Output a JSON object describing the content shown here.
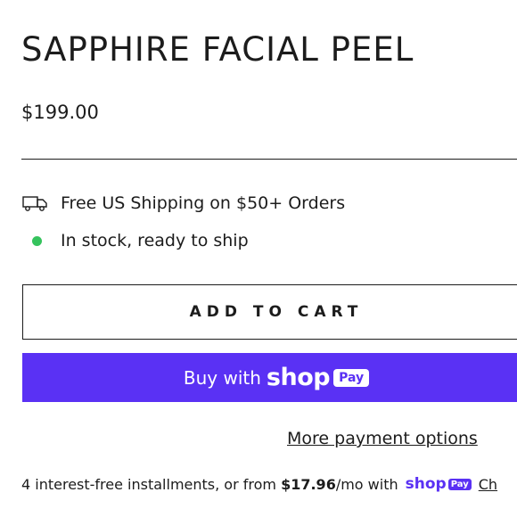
{
  "product": {
    "title": "SAPPHIRE FACIAL PEEL",
    "price": "$199.00"
  },
  "info": {
    "shipping": "Free US Shipping on $50+ Orders",
    "stock": "In stock, ready to ship",
    "stock_color": "#35c35d"
  },
  "buttons": {
    "add_to_cart": "ADD TO CART",
    "buy_with": "Buy with",
    "shop_word": "shop",
    "pay_badge": "Pay",
    "shop_color": "#5a31f4"
  },
  "more_payment": "More payment options",
  "installments": {
    "prefix": "4 interest-free installments, or from",
    "amount": "$17.96",
    "suffix": "/mo with",
    "shop": "shop",
    "pay": "Pay",
    "check": "Ch"
  },
  "icons": {
    "shipping": "truck-icon",
    "stock": "status-dot-icon"
  }
}
